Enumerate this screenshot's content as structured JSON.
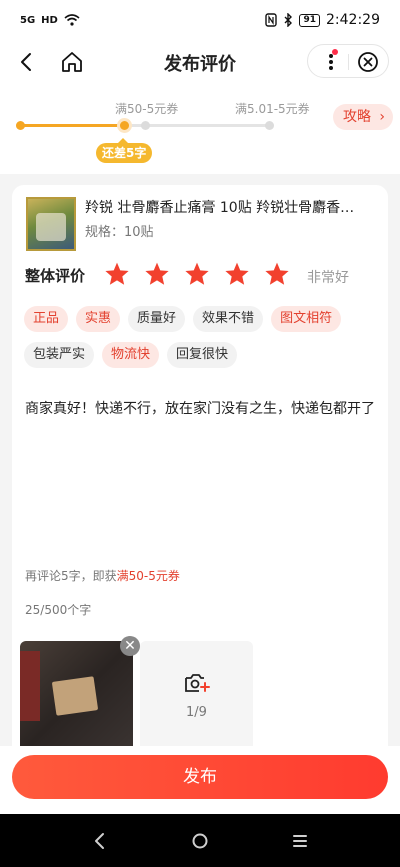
{
  "status_bar": {
    "left_indicators": [
      "5G",
      "HD"
    ],
    "time": "2:42:29",
    "battery": "91"
  },
  "header": {
    "title": "发布评价"
  },
  "progress": {
    "milestones": [
      {
        "label": "满50-5元券"
      },
      {
        "label": "满5.01-5元券"
      }
    ],
    "bubble": "还差5字",
    "tips_label": "攻略",
    "tips_arrow": "›"
  },
  "product": {
    "name": "羚锐 壮骨麝香止痛膏 10贴 羚锐壮骨麝香…",
    "spec": "规格：10贴"
  },
  "rating": {
    "label": "整体评价",
    "stars": 5,
    "text": "非常好"
  },
  "tags": [
    {
      "label": "正品",
      "selected": true
    },
    {
      "label": "实惠",
      "selected": true
    },
    {
      "label": "质量好",
      "selected": false
    },
    {
      "label": "效果不错",
      "selected": false
    },
    {
      "label": "图文相符",
      "selected": true
    },
    {
      "label": "包装严实",
      "selected": false
    },
    {
      "label": "物流快",
      "selected": true
    },
    {
      "label": "回复很快",
      "selected": false
    }
  ],
  "review": {
    "text": "商家真好！快递不行，放在家门没有之生，快递包都开了",
    "reward_prefix": "再评论5字，即获",
    "reward_coupon": "满50-5元券",
    "char_count": "25/500个字"
  },
  "photos": {
    "count_label": "1/9"
  },
  "submit": {
    "label": "发布"
  },
  "colors": {
    "accent": "#ff3b2f",
    "progress": "#f5a623",
    "tag_selected_bg": "#fde7e3",
    "tag_selected_text": "#e3412f",
    "star": "#f2412e"
  }
}
